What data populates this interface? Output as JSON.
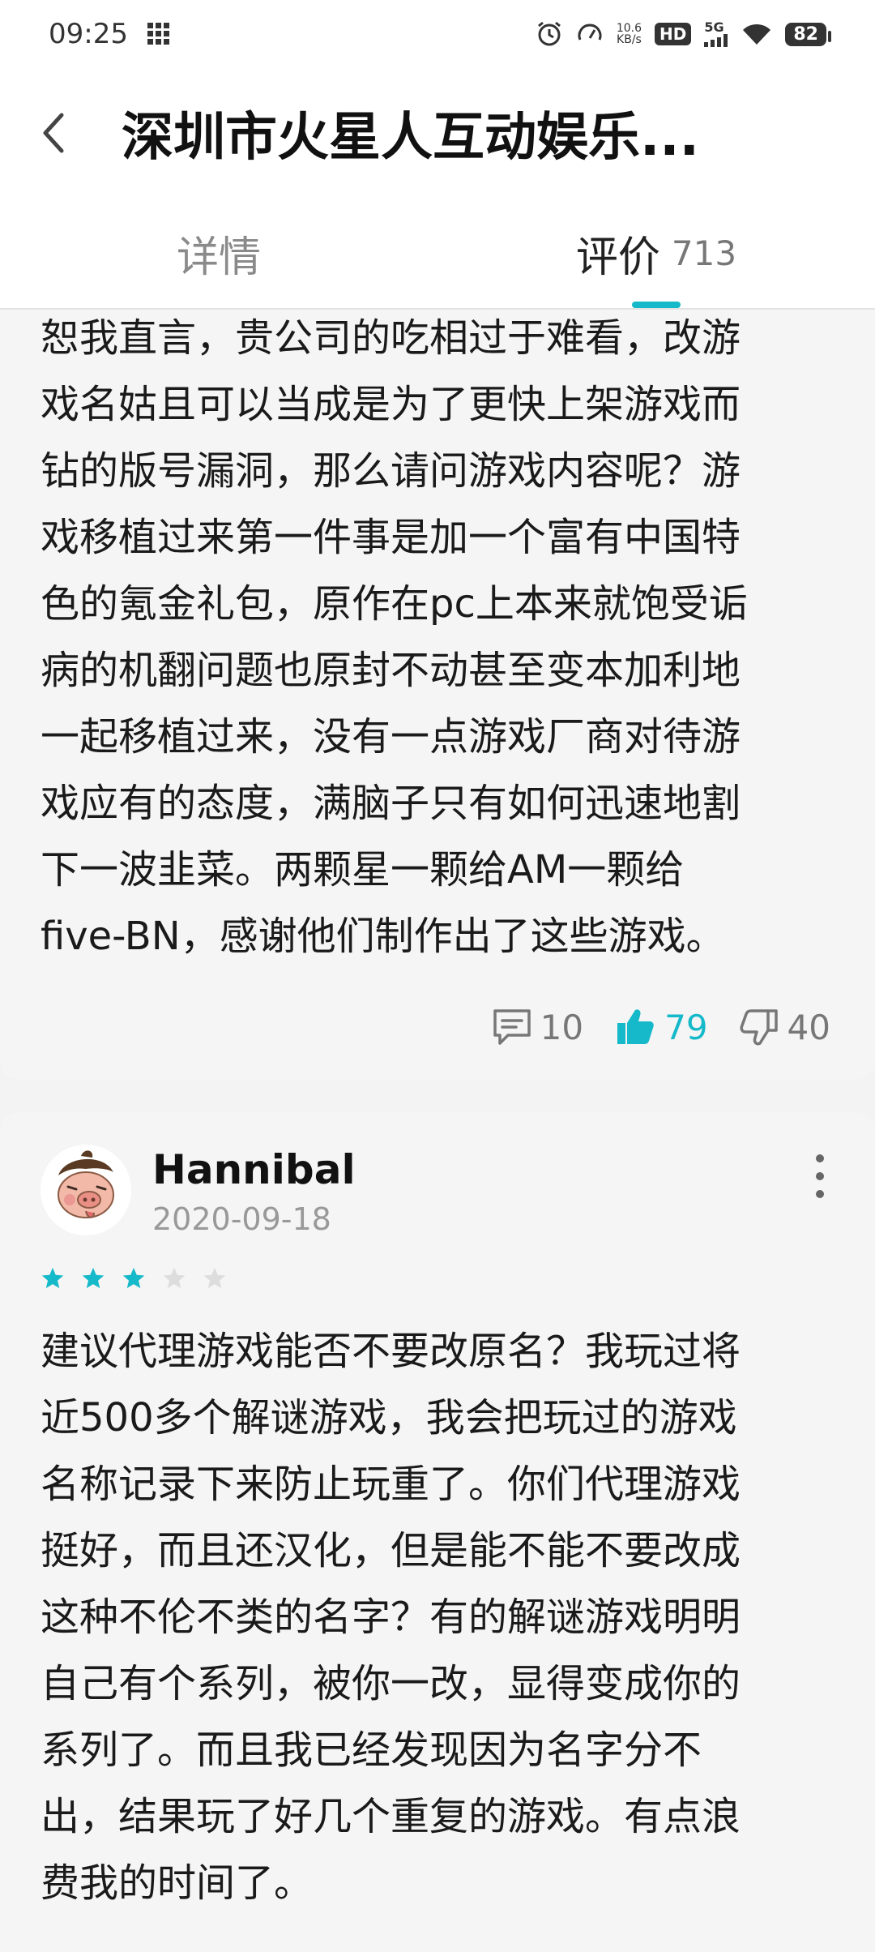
{
  "status_bar": {
    "time": "09:25",
    "net_speed_value": "10.6",
    "net_speed_unit": "KB/s",
    "hd_label": "HD",
    "signal_label": "5G",
    "battery": "82"
  },
  "header": {
    "title": "深圳市火星人互动娱乐..."
  },
  "tabs": [
    {
      "label": "详情",
      "count": ""
    },
    {
      "label": "评价",
      "count": "713"
    }
  ],
  "reviews": [
    {
      "text": "恕我直言，贵公司的吃相过于难看，改游\n戏名姑且可以当成是为了更快上架游戏而\n钻的版号漏洞，那么请问游戏内容呢？游\n戏移植过来第一件事是加一个富有中国特\n色的氪金礼包，原作在pc上本来就饱受诟\n病的机翻问题也原封不动甚至变本加利地\n一起移植过来，没有一点游戏厂商对待游\n戏应有的态度，满脑子只有如何迅速地割\n下一波韭菜。两颗星一颗给AM一颗给\nfive-BN，感谢他们制作出了这些游戏。",
      "comments": "10",
      "likes": "79",
      "dislikes": "40"
    },
    {
      "username": "Hannibal",
      "date": "2020-09-18",
      "rating": 3,
      "max_rating": 5,
      "text": "建议代理游戏能否不要改原名？我玩过将\n近500多个解谜游戏，我会把玩过的游戏\n名称记录下来防止玩重了。你们代理游戏\n挺好，而且还汉化，但是能不能不要改成\n这种不伦不类的名字？有的解谜游戏明明\n自己有个系列，被你一改，显得变成你的\n系列了。而且我已经发现因为名字分不\n出，结果玩了好几个重复的游戏。有点浪\n费我的时间了。"
    }
  ],
  "colors": {
    "accent": "#16b9c9",
    "star_empty": "#dddddd"
  }
}
